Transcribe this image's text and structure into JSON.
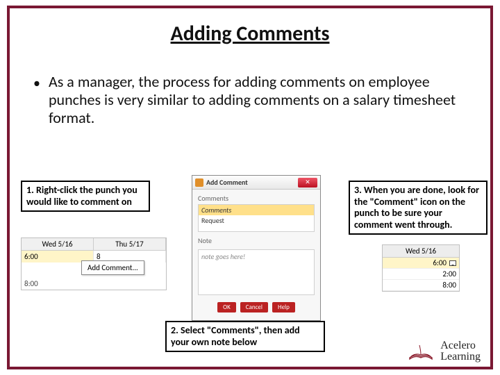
{
  "title": "Adding Comments",
  "body": "As a manager, the process for adding comments on employee punches is very similar to adding comments on a salary timesheet format.",
  "callouts": {
    "c1": "1. Right-click the punch you would like to comment on",
    "c2": "2. Select \"Comments\", then add your own note below",
    "c3": "3. When you are done, look for the \"Comment\" icon on the punch to be sure your comment went through."
  },
  "shot1": {
    "headers": [
      "Wed 5/16",
      "Thu 5/17"
    ],
    "cell_left": "6:00",
    "cell_right": "8",
    "menu_item": "Add Comment...",
    "bottom_left": "8:00"
  },
  "shot2": {
    "window_title": "Add Comment",
    "close_glyph": "✕",
    "section1": "Comments",
    "list_selected": "Comments",
    "list_item2": "Request",
    "section2": "Note",
    "note_placeholder": "note goes here!",
    "buttons": {
      "ok": "OK",
      "cancel": "Cancel",
      "help": "Help"
    }
  },
  "shot3": {
    "header": "Wed 5/16",
    "rows": [
      "6:00",
      "2:00",
      "8:00"
    ]
  },
  "logo": {
    "line1": "Acelero",
    "line2": "Learning"
  }
}
